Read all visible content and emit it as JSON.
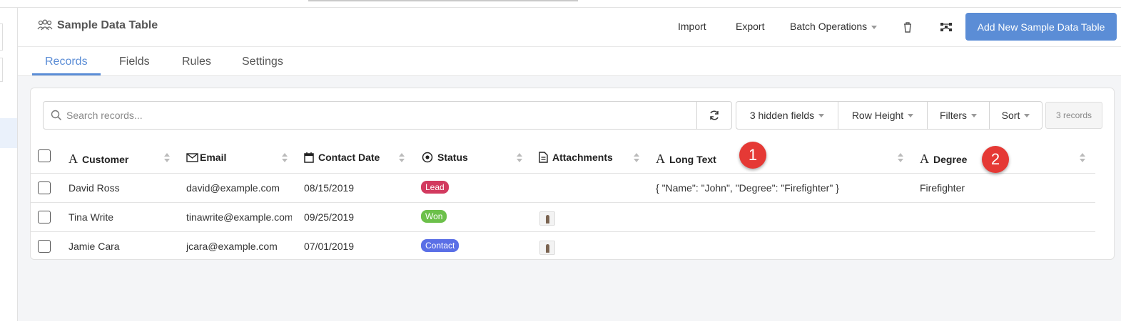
{
  "header": {
    "title": "Sample Data Table",
    "title_icon": "users-icon",
    "import_label": "Import",
    "export_label": "Export",
    "batch_label": "Batch Operations",
    "delete_icon": "trash-icon",
    "graph_icon": "network-icon",
    "add_label": "Add New Sample Data Table",
    "accent_color": "#5b8dd6"
  },
  "tabs": [
    {
      "label": "Records",
      "active": true
    },
    {
      "label": "Fields",
      "active": false
    },
    {
      "label": "Rules",
      "active": false
    },
    {
      "label": "Settings",
      "active": false
    }
  ],
  "toolbar": {
    "search_placeholder": "Search records...",
    "hidden_fields_label": "3 hidden fields",
    "row_height_label": "Row Height",
    "filters_label": "Filters",
    "sort_label": "Sort",
    "record_count": "3 records"
  },
  "columns": [
    {
      "label": "Customer",
      "icon": "text-type-icon"
    },
    {
      "label": "Email",
      "icon": "envelope-icon"
    },
    {
      "label": "Contact Date",
      "icon": "calendar-icon"
    },
    {
      "label": "Status",
      "icon": "radio-icon"
    },
    {
      "label": "Attachments",
      "icon": "document-icon"
    },
    {
      "label": "Long Text",
      "icon": "text-type-icon"
    },
    {
      "label": "Degree",
      "icon": "text-type-icon"
    }
  ],
  "rows": [
    {
      "customer": "David Ross",
      "email": "david@example.com",
      "date": "08/15/2019",
      "status": "Lead",
      "status_color": "#d23a5f",
      "attachments": 0,
      "long_text": "{ \"Name\": \"John\", \"Degree\": \"Firefighter\" }",
      "degree": "Firefighter"
    },
    {
      "customer": "Tina Write",
      "email": "tinawrite@example.com",
      "date": "09/25/2019",
      "status": "Won",
      "status_color": "#6cc04a",
      "attachments": 1,
      "long_text": "",
      "degree": ""
    },
    {
      "customer": "Jamie Cara",
      "email": "jcara@example.com",
      "date": "07/01/2019",
      "status": "Contact",
      "status_color": "#5a6fe6",
      "attachments": 1,
      "long_text": "",
      "degree": ""
    }
  ],
  "markers": [
    "1",
    "2"
  ]
}
